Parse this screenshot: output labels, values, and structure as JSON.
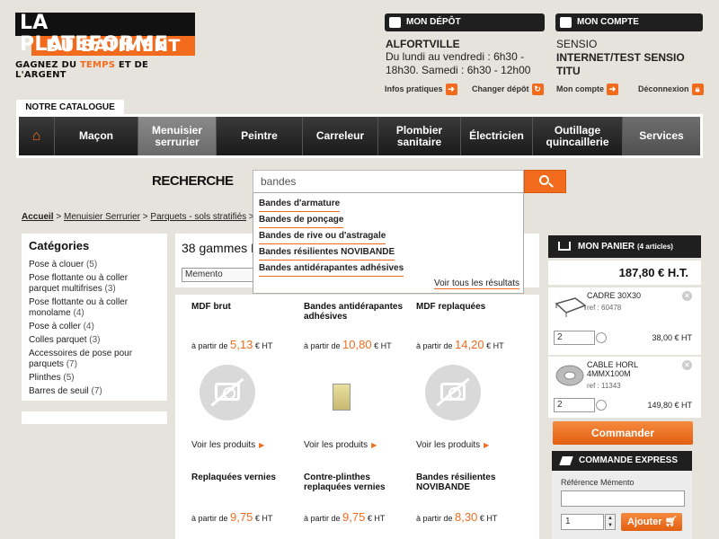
{
  "logo": {
    "line1": "LA PLATEFORME",
    "line2": "DU BATIMENT",
    "tagline_a": "GAGNEZ DU ",
    "tagline_b": "TEMPS",
    "tagline_c": " ET DE L'ARGENT"
  },
  "depot": {
    "title": "MON DÉPÔT",
    "city": "ALFORTVILLE",
    "hours_line1": "Du lundi au vendredi : 6h30 -",
    "hours_line2": "18h30. Samedi : 6h30 - 12h00",
    "infos_link": "Infos pratiques",
    "change_link": "Changer dépôt"
  },
  "account": {
    "title": "MON COMPTE",
    "name1": "SENSIO",
    "name2": "INTERNET/TEST SENSIO",
    "name3": "TITU",
    "account_link": "Mon compte",
    "logout_link": "Déconnexion"
  },
  "catalog_tab": "NOTRE CATALOGUE",
  "nav": {
    "home_icon": "home-icon",
    "items": [
      "Maçon",
      "Menuisier serrurier",
      "Peintre",
      "Carreleur",
      "Plombier sanitaire",
      "Électricien",
      "Outillage quincaillerie",
      "Services"
    ],
    "active": "Menuisier serrurier"
  },
  "search": {
    "label": "RECHERCHE",
    "value": "bandes",
    "suggestions": [
      "Bandes d'armature",
      "Bandes de ponçage",
      "Bandes de rive ou d'astragale",
      "Bandes résilientes NOVIBANDE",
      "Bandes antidérapantes adhésives"
    ],
    "see_all": "Voir tous les résultats"
  },
  "breadcrumb": {
    "home": "Accueil",
    "sep": " > ",
    "level1": "Menuisier Serrurier",
    "level2": "Parquets - sols stratifiés",
    "level3": "Pa"
  },
  "categories": {
    "title": "Catégories",
    "items": [
      {
        "label": "Pose à clouer",
        "count": "(5)"
      },
      {
        "label": "Pose flottante ou à coller parquet multifrises",
        "count": "(3)"
      },
      {
        "label": "Pose flottante ou à coller monolame",
        "count": "(4)"
      },
      {
        "label": "Pose à coller",
        "count": "(4)"
      },
      {
        "label": "Colles parquet",
        "count": "(3)"
      },
      {
        "label": "Accessoires de pose pour parquets",
        "count": "(7)"
      },
      {
        "label": "Plinthes",
        "count": "(5)"
      },
      {
        "label": "Barres de seuil",
        "count": "(7)"
      }
    ]
  },
  "gammes": {
    "title": "38 gammes P",
    "sort_value": "Memento"
  },
  "products": [
    {
      "name": "MDF brut",
      "prefix": "à partir de",
      "price": "5,13",
      "suffix": "€ HT",
      "link": "Voir les produits",
      "image": "no-image"
    },
    {
      "name": "Bandes antidérapantes adhésives",
      "prefix": "à partir de",
      "price": "10,80",
      "suffix": "€ HT",
      "link": "Voir les produits",
      "image": "product-photo"
    },
    {
      "name": "MDF replaquées",
      "prefix": "à partir de",
      "price": "14,20",
      "suffix": "€ HT",
      "link": "Voir les produits",
      "image": "no-image"
    },
    {
      "name": "Replaquées vernies",
      "prefix": "à partir de",
      "price": "9,75",
      "suffix": "€ HT"
    },
    {
      "name": "Contre-plinthes replaquées vernies",
      "prefix": "à partir de",
      "price": "9,75",
      "suffix": "€ HT"
    },
    {
      "name": "Bandes résilientes NOVIBANDE",
      "prefix": "à partir de",
      "price": "8,30",
      "suffix": "€ HT"
    }
  ],
  "cart": {
    "title": "MON PANIER",
    "count": "(4 articles)",
    "total": "187,80 € H.T.",
    "items": [
      {
        "name1": "CADRE 30X30",
        "name2": "",
        "ref": "ref : 60478",
        "qty": "2",
        "price": "38,00 € HT"
      },
      {
        "name1": "CABLE HORL",
        "name2": "4MMX100M",
        "ref": "ref : 11343",
        "qty": "2",
        "price": "149,80 € HT"
      }
    ],
    "order_button": "Commander"
  },
  "express": {
    "title": "COMMANDE EXPRESS",
    "ref_label": "Référence Mémento",
    "qty": "1",
    "add_button": "Ajouter"
  },
  "colors": {
    "accent": "#f26b1d",
    "dark": "#1f1f1f",
    "background": "#e6e2dc"
  }
}
